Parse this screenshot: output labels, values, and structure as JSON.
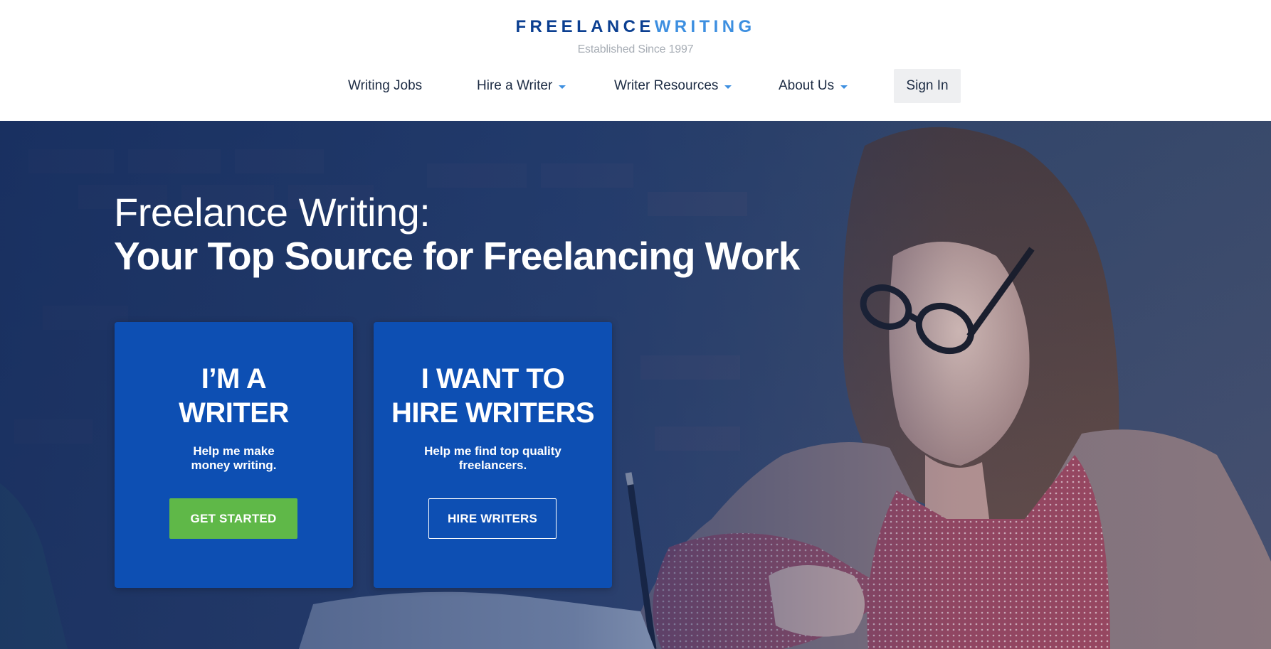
{
  "brand": {
    "logo_part1": "FREELANCE",
    "logo_part2": "WRITING",
    "tagline": "Established Since 1997",
    "colors": {
      "primary": "#0b3f91",
      "accent": "#3d8fe0",
      "card": "#0d4fb3",
      "cta": "#5fb848"
    }
  },
  "nav": {
    "items": [
      {
        "label": "Writing Jobs",
        "has_dropdown": false
      },
      {
        "label": "Hire a Writer",
        "has_dropdown": true
      },
      {
        "label": "Writer Resources",
        "has_dropdown": true
      },
      {
        "label": "About Us",
        "has_dropdown": true
      }
    ],
    "sign_in": "Sign In",
    "dropdown_icon": "caret-down-icon"
  },
  "hero": {
    "title_line1": "Freelance Writing:",
    "title_line2": "Your Top Source for Freelancing Work",
    "image": "woman-writing-photo",
    "cards": [
      {
        "title_line1": "I’M A",
        "title_line2": "WRITER",
        "sub_line1": "Help me make",
        "sub_line2": "money writing.",
        "button": "GET STARTED"
      },
      {
        "title_line1": "I WANT TO",
        "title_line2": "HIRE WRITERS",
        "sub_line1": "Help me find top quality",
        "sub_line2": "freelancers.",
        "button": "HIRE WRITERS"
      }
    ]
  }
}
